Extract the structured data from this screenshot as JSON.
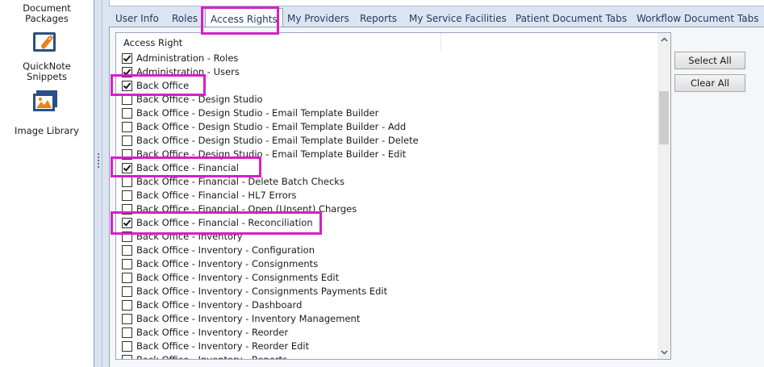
{
  "left_nav": {
    "items": [
      {
        "label_line1": "Document",
        "label_line2": "Packages",
        "icon": "document-packages-icon"
      },
      {
        "label_line1": "QuickNote",
        "label_line2": "Snippets",
        "icon": "paperclip-icon"
      },
      {
        "label_line1": "Image Library",
        "label_line2": "",
        "icon": "image-library-icon"
      }
    ]
  },
  "tabs": [
    {
      "label": "User Info",
      "active": false
    },
    {
      "label": "Roles",
      "active": false
    },
    {
      "label": "Access Rights",
      "active": true
    },
    {
      "label": "My Providers",
      "active": false
    },
    {
      "label": "Reports",
      "active": false
    },
    {
      "label": "My Service Facilities",
      "active": false
    },
    {
      "label": "Patient Document Tabs",
      "active": false
    },
    {
      "label": "Workflow Document Tabs",
      "active": false
    }
  ],
  "access_rights": {
    "column_header": "Access Right",
    "rows": [
      {
        "label": "Administration - Roles",
        "checked": true
      },
      {
        "label": "Administration - Users",
        "checked": true
      },
      {
        "label": "Back Office",
        "checked": true
      },
      {
        "label": "Back Office - Design Studio",
        "checked": false
      },
      {
        "label": "Back Office - Design Studio - Email Template Builder",
        "checked": false
      },
      {
        "label": "Back Office - Design Studio - Email Template Builder - Add",
        "checked": false
      },
      {
        "label": "Back Office - Design Studio - Email Template Builder - Delete",
        "checked": false
      },
      {
        "label": "Back Office - Design Studio - Email Template Builder - Edit",
        "checked": false
      },
      {
        "label": "Back Office - Financial",
        "checked": true
      },
      {
        "label": "Back Office - Financial - Delete Batch Checks",
        "checked": false
      },
      {
        "label": "Back Office - Financial - HL7 Errors",
        "checked": false
      },
      {
        "label": "Back Office - Financial - Open (Unsent) Charges",
        "checked": false
      },
      {
        "label": "Back Office - Financial - Reconciliation",
        "checked": true
      },
      {
        "label": "Back Office - Inventory",
        "checked": false
      },
      {
        "label": "Back Office - Inventory - Configuration",
        "checked": false
      },
      {
        "label": "Back Office - Inventory - Consignments",
        "checked": false
      },
      {
        "label": "Back Office - Inventory - Consignments Edit",
        "checked": false
      },
      {
        "label": "Back Office - Inventory - Consignments Payments Edit",
        "checked": false
      },
      {
        "label": "Back Office - Inventory - Dashboard",
        "checked": false
      },
      {
        "label": "Back Office - Inventory - Inventory Management",
        "checked": false
      },
      {
        "label": "Back Office - Inventory - Reorder",
        "checked": false
      },
      {
        "label": "Back Office - Inventory - Reorder Edit",
        "checked": false
      },
      {
        "label": "Back Office - Inventory - Reports",
        "checked": false
      }
    ]
  },
  "buttons": {
    "select_all": "Select All",
    "clear_all": "Clear All"
  },
  "colors": {
    "highlight": "#d81ec8",
    "tab_text": "#233a5e",
    "panel_bg": "#dbe5f1"
  }
}
